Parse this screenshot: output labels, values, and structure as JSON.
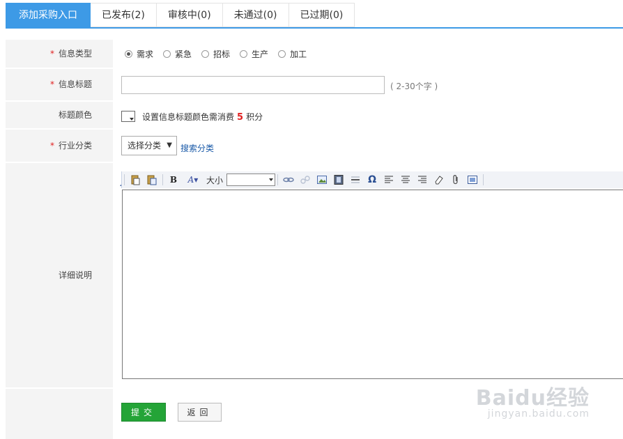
{
  "tabs": [
    {
      "label": "添加采购入口",
      "active": true
    },
    {
      "label": "已发布(2)",
      "active": false
    },
    {
      "label": "审核中(0)",
      "active": false
    },
    {
      "label": "未通过(0)",
      "active": false
    },
    {
      "label": "已过期(0)",
      "active": false
    }
  ],
  "form": {
    "required_mark": "*",
    "info_type": {
      "label": "信息类型",
      "options": [
        "需求",
        "紧急",
        "招标",
        "生产",
        "加工"
      ],
      "selected": "需求"
    },
    "title": {
      "label": "信息标题",
      "value": "",
      "hint": "( 2-30个字 )"
    },
    "title_color": {
      "label": "标题颜色",
      "text_before": "设置信息标题颜色需消费",
      "points": "5",
      "text_after": "积分"
    },
    "industry": {
      "label": "行业分类",
      "select_value": "选择分类",
      "search_link": "搜索分类"
    },
    "detail": {
      "label": "详细说明",
      "toolbar_size_label": "大小"
    },
    "buttons": {
      "submit": "提交",
      "back": "返回"
    }
  },
  "watermark": {
    "brand": "Baidu经验",
    "url": "jingyan.baidu.com"
  }
}
